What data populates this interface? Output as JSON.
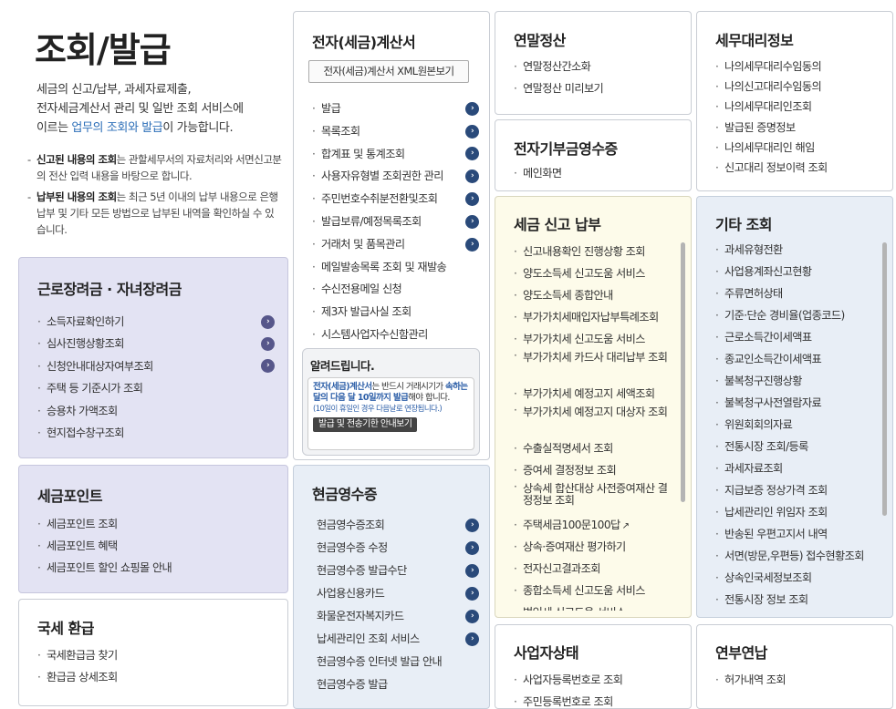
{
  "hero": {
    "title": "조회/발급",
    "desc_line1": "세금의 신고/납부, 과세자료제출,",
    "desc_line2": "전자세금계산서 관리 및 일반 조회 서비스에",
    "desc_line3_pre": "이르는 ",
    "desc_line3_hl": "업무의 조회와 발급",
    "desc_line3_post": "이 가능합니다.",
    "note1_bold": "신고된 내용의 조회",
    "note1_rest": "는 관할세무서의 자료처리와 서면신고분의 전산 입력 내용을 바탕으로 합니다.",
    "note2_bold": "납부된 내용의 조회",
    "note2_rest": "는 최근 5년 이내의 납부 내용으로 은행 납부 및 기타 모든 방법으로 납부된 내역을 확인하실 수 있습니다."
  },
  "earned": {
    "title": "근로장려금 · 자녀장려금",
    "items": [
      "소득자료확인하기",
      "심사진행상황조회",
      "신청안내대상자여부조회",
      "주택 등 기준시가 조회",
      "승용차 가액조회",
      "현지접수창구조회"
    ]
  },
  "point": {
    "title": "세금포인트",
    "items": [
      "세금포인트 조회",
      "세금포인트 혜택",
      "세금포인트 할인 쇼핑몰 안내"
    ]
  },
  "refund": {
    "title": "국세 환급",
    "items": [
      "국세환급금 찾기",
      "환급금 상세조회"
    ]
  },
  "einvoice": {
    "title": "전자(세금)계산서",
    "xml_button": "전자(세금)계산서 XML원본보기",
    "items": [
      "발급",
      "목록조회",
      "합계표 및 통계조회",
      "사용자유형별 조회권한 관리",
      "주민번호수취분전환및조회",
      "발급보류/예정목록조회",
      "거래처 및 품목관리",
      "메일발송목록 조회 및 재발송",
      "수신전용메일 신청",
      "제3자 발급사실 조회",
      "시스템사업자수신함관리"
    ],
    "notice": {
      "title": "알려드립니다.",
      "b1": "전자(세금)계산서",
      "t1": "는 반드시 거래시기가",
      "b2": "속하는 달의 다음 달 10일까지 발급",
      "t2": "해야 합니다.",
      "small": "(10일이 휴일인 경우 다음날로 연장됩니다.)",
      "button": "발급 및 전송기한 안내보기"
    }
  },
  "cash": {
    "title": "현금영수증",
    "items": [
      "현금영수증조회",
      "현금영수증 수정",
      "현금영수증 발급수단",
      "사업용신용카드",
      "화물운전자복지카드",
      "납세관리인 조회 서비스",
      "현금영수증 인터넷 발급 안내",
      "현금영수증 발급"
    ]
  },
  "yearend": {
    "title": "연말정산",
    "items": [
      "연말정산간소화",
      "연말정산 미리보기"
    ]
  },
  "donation": {
    "title": "전자기부금영수증",
    "items": [
      "메인화면"
    ]
  },
  "taxfiling": {
    "title": "세금 신고 납부",
    "items": [
      "신고내용확인 진행상황 조회",
      "양도소득세 신고도움 서비스",
      "양도소득세 종합안내",
      "부가가치세매입자납부특례조회",
      "부가가치세 신고도움 서비스",
      "부가가치세 카드사 대리납부 조회",
      "부가가치세 예정고지 세액조회",
      "부가가치세 예정고지 대상자 조회",
      "수출실적명세서 조회",
      "증여세 결정정보 조회",
      "상속세 합산대상 사전증여재산 결정정보 조회",
      "주택세금100문100답",
      "상속·증여재산 평가하기",
      "전자신고결과조회",
      "종합소득세 신고도움 서비스",
      "법인세 신고도움 서비스"
    ]
  },
  "business": {
    "title": "사업자상태",
    "items": [
      "사업자등록번호로 조회",
      "주민등록번호로 조회"
    ]
  },
  "agent": {
    "title": "세무대리정보",
    "items": [
      "나의세무대리수임동의",
      "나의신고대리수임동의",
      "나의세무대리인조회",
      "발급된 증명정보",
      "나의세무대리인 해임",
      "신고대리 정보이력 조회"
    ]
  },
  "other": {
    "title": "기타 조회",
    "items": [
      "과세유형전환",
      "사업용계좌신고현황",
      "주류면허상태",
      "기준·단순 경비율(업종코드)",
      "근로소득간이세액표",
      "종교인소득간이세액표",
      "불복청구진행상황",
      "불복청구사전열람자료",
      "위원회회의자료",
      "전통시장 조회/등록",
      "과세자료조회",
      "지급보증 정상가격 조회",
      "납세관리인 위임자 조회",
      "반송된 우편고지서 내역",
      "서면(방문,우편등) 접수현황조회",
      "상속인국세정보조회",
      "전통시장 정보 조회"
    ]
  },
  "license": {
    "title": "연부연납",
    "items": [
      "허가내역 조회"
    ]
  },
  "icons": {
    "arrow": "›",
    "external": "↗"
  }
}
